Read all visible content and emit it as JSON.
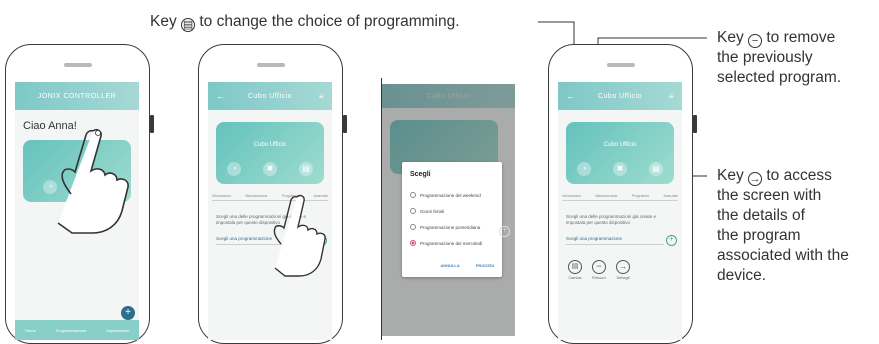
{
  "annotations": {
    "top_prefix": "Key",
    "top_suffix": "to change the choice of programming.",
    "remove_prefix": "Key",
    "remove_suffix": "to remove",
    "remove_l2": "the previously",
    "remove_l3": "selected program.",
    "access_prefix": "Key",
    "access_suffix": "to access",
    "access_l2": "the screen with",
    "access_l3": "the details of",
    "access_l4": "the program",
    "access_l5": "associated with the",
    "access_l6": "device."
  },
  "phone1": {
    "app_title": "JONIX CONTROLLER",
    "greeting": "Ciao Anna!",
    "nav": [
      "Home",
      "Programmazione",
      "Impostazioni"
    ]
  },
  "phone2": {
    "title": "Cubo Ufficio",
    "card_title": "Cubo Ufficio",
    "tabs": [
      "Informazioni",
      "Manutenzione",
      "Programmi",
      "Avanzate"
    ],
    "desc": "Scegli una delle programmazioni già create e impostala per questo dispositivo",
    "choose": "Scegli una programmazione"
  },
  "dialog": {
    "title": "Scegli",
    "options": [
      "Programmazione del weekend",
      "Giorni feriali",
      "Programmazione pomeridiana",
      "Programmazione dei mercoledì"
    ],
    "cancel": "ANNULLA",
    "proceed": "PROCEDI"
  },
  "phone4": {
    "title": "Cubo Ufficio",
    "card_title": "Cubo Ufficio",
    "tabs": [
      "Informazioni",
      "Manutenzione",
      "Programmi",
      "Avanzate"
    ],
    "desc": "Scegli una delle programmazioni già create e impostala per questo dispositivo",
    "choose": "Scegli una programmazione",
    "actions": [
      "Cambia",
      "Rimuovi",
      "Dettagli"
    ]
  },
  "icons": {
    "change": "change-list-icon",
    "remove": "minus-circle-icon",
    "access": "arrow-right-circle-icon"
  }
}
